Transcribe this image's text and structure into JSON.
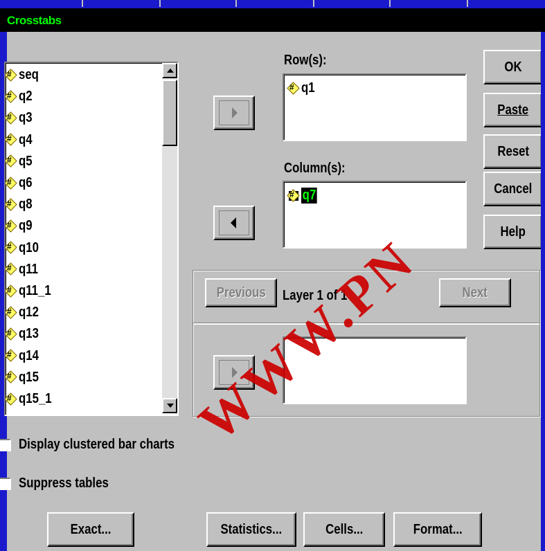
{
  "window": {
    "title": "Crosstabs"
  },
  "variables": [
    "seq",
    "q2",
    "q3",
    "q4",
    "q5",
    "q6",
    "q8",
    "q9",
    "q10",
    "q11",
    "q11_1",
    "q12",
    "q13",
    "q14",
    "q15",
    "q15_1"
  ],
  "rows": {
    "label": "Row(s):",
    "items": [
      "q1"
    ]
  },
  "columns": {
    "label": "Column(s):",
    "items": [
      "q7"
    ]
  },
  "layer": {
    "previous_label": "Previous",
    "next_label": "Next",
    "status": "Layer 1 of 1"
  },
  "buttons": {
    "ok": "OK",
    "paste": "Paste",
    "reset": "Reset",
    "cancel": "Cancel",
    "help": "Help"
  },
  "options": {
    "clustered_bar_charts": "Display clustered bar charts",
    "suppress_tables": "Suppress tables"
  },
  "bottom_buttons": {
    "exact": "Exact...",
    "statistics": "Statistics...",
    "cells": "Cells...",
    "format": "Format..."
  },
  "watermark": "WWW.PN",
  "colors": {
    "background": "#1a1acc",
    "dialog": "#c0c0c0",
    "title_text": "#00ff00",
    "watermark": "#cc0000"
  }
}
